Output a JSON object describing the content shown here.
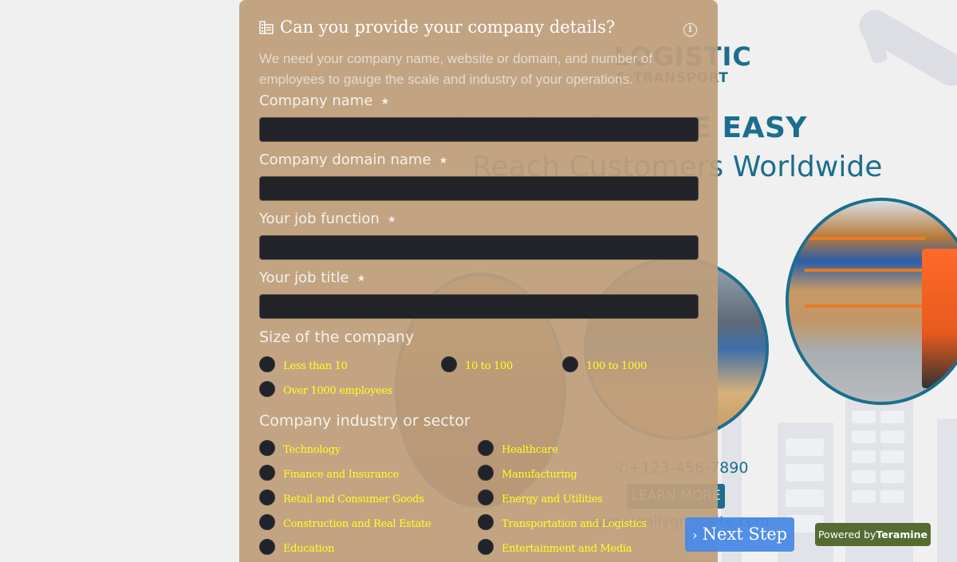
{
  "form": {
    "title": "Can you provide your company details?",
    "title_icon": "building-icon",
    "info_icon": "info-icon",
    "description": "We need your company name, website or domain, and number of employees to gauge the scale and industry of your operations.",
    "required_marker": "★",
    "fields": [
      {
        "label": "Company name",
        "value": "",
        "placeholder": "",
        "required": true
      },
      {
        "label": "Company domain name",
        "value": "",
        "placeholder": "",
        "required": true
      },
      {
        "label": "Your job function",
        "value": "",
        "placeholder": "",
        "required": true
      },
      {
        "label": "Your job title",
        "value": "",
        "placeholder": "",
        "required": true
      }
    ],
    "size_section": {
      "label": "Size of the company",
      "options": [
        "Less than 10",
        "10 to 100",
        "100 to 1000",
        "Over 1000 employees"
      ],
      "selected": null
    },
    "industry_section": {
      "label": "Company industry or sector",
      "options": [
        "Technology",
        "Healthcare",
        "Finance and Insurance",
        "Manufacturing",
        "Retail and Consumer Goods",
        "Energy and Utilities",
        "Construction and Real Estate",
        "Transportation and Logistics",
        "Education",
        "Entertainment and Media"
      ],
      "selected": null
    }
  },
  "footer": {
    "next_label": "Next Step",
    "next_icon": "chevron-right-icon",
    "powered_prefix": "Powered by",
    "powered_brand": "Teramine"
  },
  "background": {
    "logo_line1": "LOGISTIC",
    "logo_line2": "& TRANSPORT",
    "headline": "SHIPPING MADE EASY",
    "subline": "Reach Customers Worldwide",
    "phone": "+123-456-7890",
    "learn_more": "LEARN MORE",
    "website": "www.reallygreatsite.com"
  },
  "colors": {
    "panel": "#be9e7b",
    "input": "#212328",
    "option_text": "#ffff1e",
    "next_button": "#4a89e6",
    "powered_badge": "#566b32",
    "brand_teal": "#1b6e8e"
  }
}
